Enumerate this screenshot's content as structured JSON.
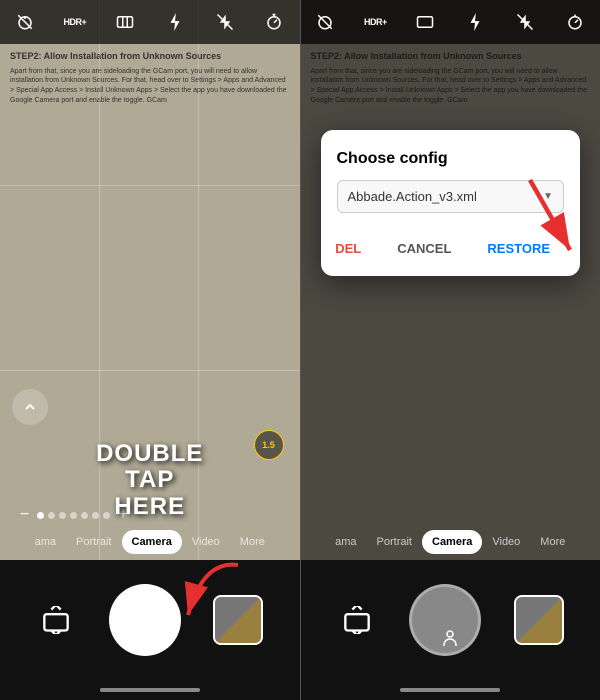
{
  "left_panel": {
    "toolbar_icons": [
      {
        "name": "timer-off-icon",
        "symbol": "⊘"
      },
      {
        "name": "hdr-plus-icon",
        "symbol": "HDR+"
      },
      {
        "name": "panorama-icon",
        "symbol": "⊟"
      },
      {
        "name": "flash-icon",
        "symbol": "⚡"
      },
      {
        "name": "flash-off-icon",
        "symbol": "✗"
      },
      {
        "name": "timer-icon",
        "symbol": "⏱"
      }
    ],
    "paper_heading": "STEP2: Allow Installation from Unknown Sources",
    "paper_body": "Apart from that, since you are sideloading the GCam port, you will need to allow installation from Unknown Sources. For that, head over to Settings > Apps and Advanced > Special App Access > Install Unknown Apps > Select the app you have downloaded the Google Camera port and enable the toggle. GCam",
    "double_tap_lines": [
      "DOUBLE",
      "TAP",
      "HERE"
    ],
    "zoom_label": "1.5",
    "slider_label": "-",
    "slider_plus": "+",
    "mode_tabs": [
      {
        "label": "ama",
        "active": false
      },
      {
        "label": "Portrait",
        "active": false
      },
      {
        "label": "Camera",
        "active": true
      },
      {
        "label": "Video",
        "active": false
      },
      {
        "label": "More",
        "active": false
      }
    ]
  },
  "right_panel": {
    "toolbar_icons": [
      {
        "name": "timer-off-icon-r",
        "symbol": "⊘"
      },
      {
        "name": "hdr-plus-icon-r",
        "symbol": "HDR+"
      },
      {
        "name": "panorama-icon-r",
        "symbol": "⊟"
      },
      {
        "name": "flash-icon-r",
        "symbol": "⚡"
      },
      {
        "name": "flash-off-icon-r",
        "symbol": "✗"
      },
      {
        "name": "timer-icon-r",
        "symbol": "⏱"
      }
    ],
    "dialog": {
      "title": "Choose config",
      "selected_value": "Abbade.Action_v3.xml",
      "dropdown_arrow": "▼",
      "buttons": [
        {
          "label": "DEL",
          "type": "del"
        },
        {
          "label": "CANCEL",
          "type": "cancel"
        },
        {
          "label": "RESTORE",
          "type": "restore"
        }
      ]
    },
    "mode_tabs": [
      {
        "label": "ama",
        "active": false
      },
      {
        "label": "Portrait",
        "active": false
      },
      {
        "label": "Camera",
        "active": true
      },
      {
        "label": "Video",
        "active": false
      },
      {
        "label": "More",
        "active": false
      }
    ],
    "more_label": "More"
  }
}
